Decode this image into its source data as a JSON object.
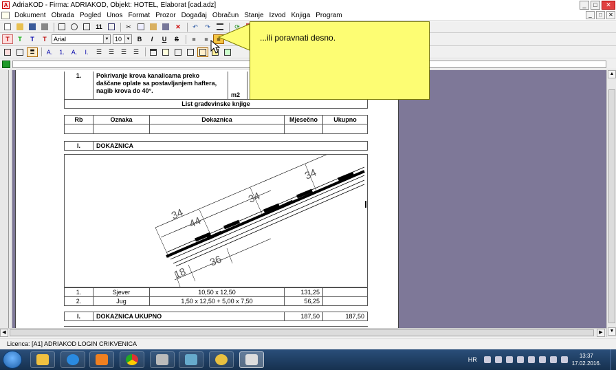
{
  "window": {
    "title": "AdriaKOD - Firma: ADRIAKOD,   Objekt: HOTEL,  Elaborat [cad.adz]"
  },
  "menu": {
    "items": [
      "Dokument",
      "Obrada",
      "Pogled",
      "Unos",
      "Format",
      "Prozor",
      "Događaj",
      "Obračun",
      "Stanje",
      "Izvod",
      "Knjiga",
      "Program"
    ]
  },
  "toolbar2": {
    "t_labels": [
      "T",
      "T",
      "T",
      "T"
    ],
    "font": "Arial",
    "size": "10",
    "bold": "B",
    "italic": "I",
    "underline": "U",
    "strike": "S"
  },
  "toolbar3": {
    "a_labels": [
      "A.",
      "1.",
      "A.",
      "I."
    ]
  },
  "callout": {
    "text": "...ili poravnati desno."
  },
  "document": {
    "item": {
      "num": "1.",
      "desc": "Pokrivanje krova kanalicama preko daščane oplate sa postavljanjem haftera, nagib krova do 40°.",
      "unit": "m2"
    },
    "list_title": "List građevinske knjige",
    "headers": {
      "rb": "Rb",
      "oznaka": "Oznaka",
      "dokaznica": "Dokaznica",
      "mjesecno": "Mjesečno",
      "ukupno": "Ukupno"
    },
    "section": {
      "num": "I.",
      "label": "DOKAZNICA"
    },
    "drawing_dims": {
      "d1": "34",
      "d2": "44",
      "d3": "34",
      "d4": "34",
      "d5": "18",
      "d6": "36"
    },
    "rows": [
      {
        "rb": "1.",
        "oznaka": "Sjever",
        "dokaznica": "10,50 x 12,50",
        "mjesecno": "131,25",
        "ukupno": ""
      },
      {
        "rb": "2.",
        "oznaka": "Jug",
        "dokaznica": "1,50 x 12,50 + 5,00 x 7,50",
        "mjesecno": "56,25",
        "ukupno": ""
      }
    ],
    "total": {
      "num": "I.",
      "label": "DOKAZNICA UKUPNO",
      "mjesecno": "187,50",
      "ukupno": "187,50"
    }
  },
  "status": {
    "text": "Licenca: [A1] ADRIAKOD LOGIN CRIKVENICA"
  },
  "tray": {
    "lang": "HR",
    "time": "13:37",
    "date": "17.02.2016."
  },
  "colors": {
    "workspace": "#7e7898",
    "callout": "#fdfd73",
    "taskbar": "#1e3d62"
  }
}
